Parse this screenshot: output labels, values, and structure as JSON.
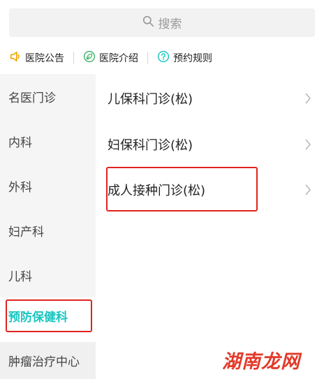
{
  "search": {
    "placeholder": "搜索"
  },
  "notices": [
    {
      "label": "医院公告",
      "icon": "speaker-icon",
      "color": "#f0a500"
    },
    {
      "label": "医院介绍",
      "icon": "leaf-icon",
      "color": "#45b36b"
    },
    {
      "label": "预约规则",
      "icon": "question-icon",
      "color": "#19c6c0"
    }
  ],
  "sidebar": {
    "items": [
      {
        "label": "名医门诊"
      },
      {
        "label": "内科"
      },
      {
        "label": "外科"
      },
      {
        "label": "妇产科"
      },
      {
        "label": "儿科"
      },
      {
        "label": "预防保健科",
        "active": true
      },
      {
        "label": "肿瘤治疗中心"
      }
    ]
  },
  "list": {
    "items": [
      {
        "label": "儿保科门诊(松)"
      },
      {
        "label": "妇保科门诊(松)"
      },
      {
        "label": "成人接种门诊(松)"
      }
    ]
  },
  "watermark": "湖南龙网",
  "colors": {
    "accent": "#19c6c0",
    "highlight": "#e0241f"
  }
}
